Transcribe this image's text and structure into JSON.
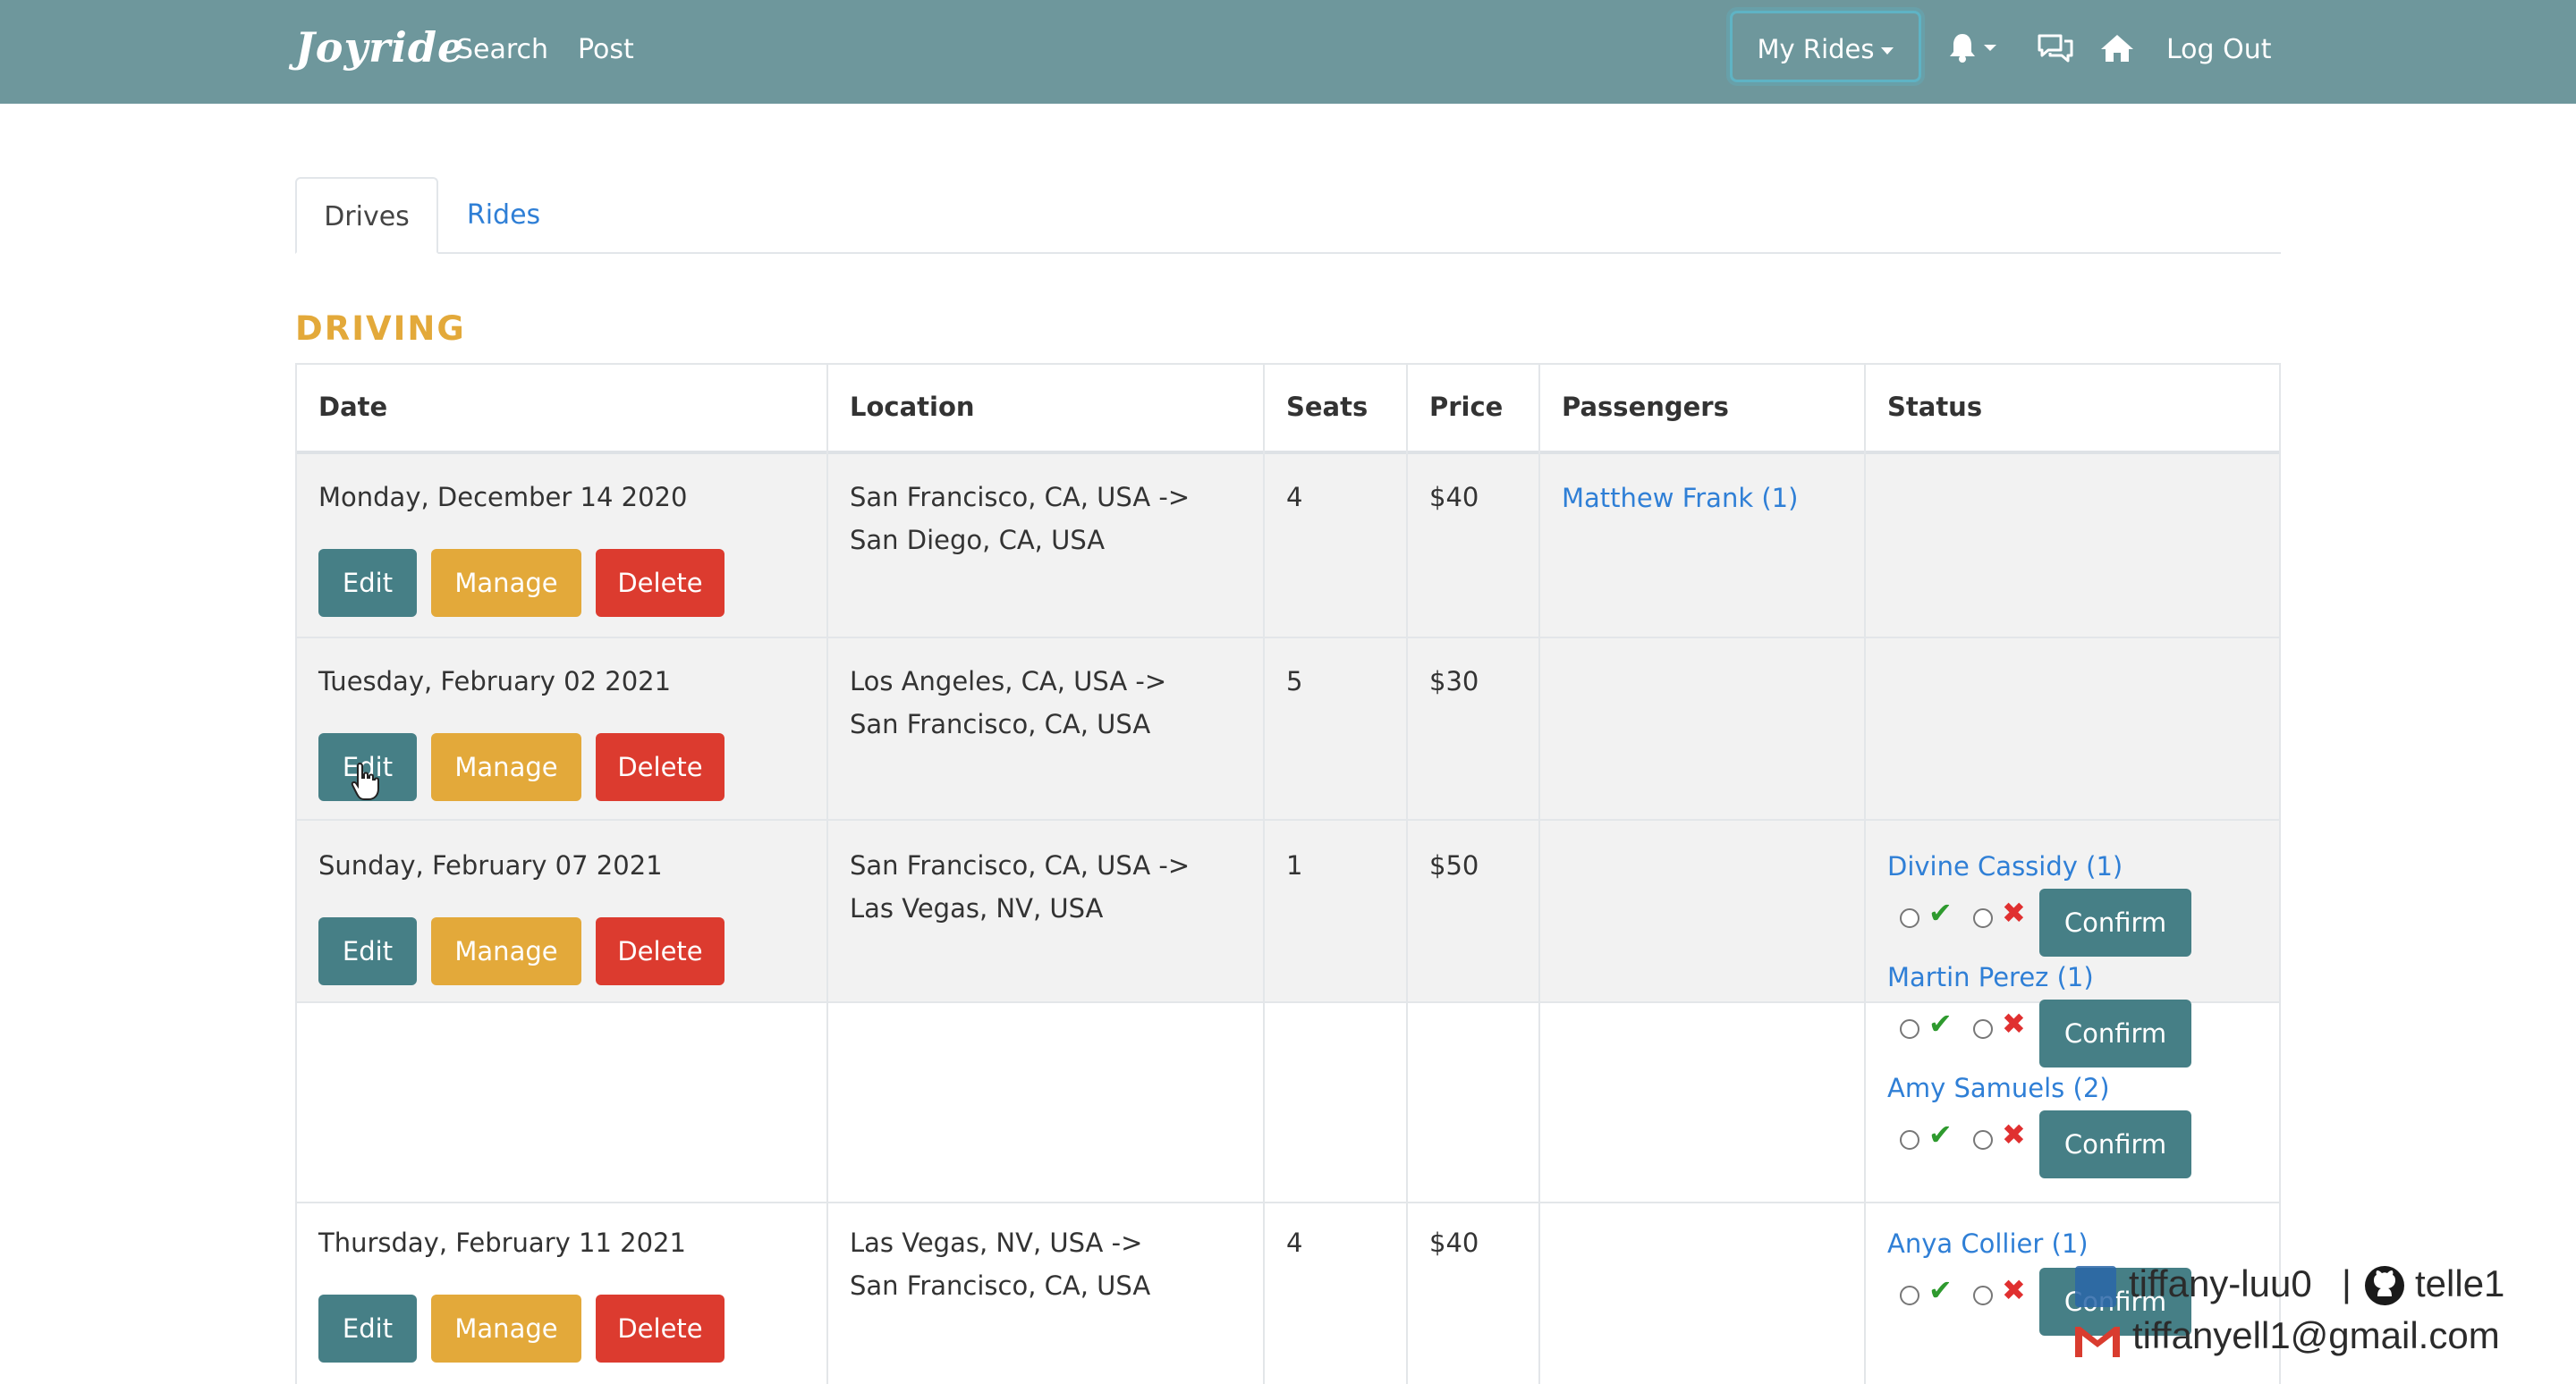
{
  "nav": {
    "brand": "Joyride",
    "search": "Search",
    "post": "Post",
    "my_rides": "My Rides",
    "logout": "Log Out"
  },
  "tabs": {
    "drives": "Drives",
    "rides": "Rides"
  },
  "section_title": "DRIVING",
  "table": {
    "headers": [
      "Date",
      "Location",
      "Seats",
      "Price",
      "Passengers",
      "Status"
    ],
    "buttons": {
      "edit": "Edit",
      "manage": "Manage",
      "delete": "Delete",
      "confirm": "Confirm"
    },
    "rows": [
      {
        "date": "Monday, December 14 2020",
        "from": "San Francisco, CA, USA ->",
        "to": "San Diego, CA, USA",
        "seats": "4",
        "price": "$40",
        "passengers": [
          "Matthew Frank (1)"
        ],
        "status": []
      },
      {
        "date": "Tuesday, February 02 2021",
        "from": "Los Angeles, CA, USA ->",
        "to": "San Francisco, CA, USA",
        "seats": "5",
        "price": "$30",
        "passengers": [],
        "status": []
      },
      {
        "date": "Sunday, February 07 2021",
        "from": "San Francisco, CA, USA ->",
        "to": "Las Vegas, NV, USA",
        "seats": "1",
        "price": "$50",
        "passengers": [],
        "status": [
          "Divine Cassidy (1)",
          "Martin Perez (1)",
          "Amy Samuels (2)"
        ]
      },
      {
        "date": "Thursday, February 11 2021",
        "from": "Las Vegas, NV, USA ->",
        "to": "San Francisco, CA, USA",
        "seats": "4",
        "price": "$40",
        "passengers": [],
        "status": [
          "Anya Collier (1)"
        ]
      }
    ]
  },
  "watermark": {
    "github_user": "tiffany-luu0",
    "separator": "|",
    "github_name": "telle1",
    "email": "tiffanyell1@gmail.com"
  },
  "colors": {
    "navbar": "#6e979c",
    "accent_orange": "#e3a93a",
    "edit_teal": "#467f86",
    "delete_red": "#dc3b2f",
    "link_blue": "#2f7fd6"
  },
  "icons": [
    "bell-icon",
    "chat-icon",
    "home-icon",
    "check-icon",
    "cross-icon",
    "linkedin-icon",
    "github-icon",
    "gmail-icon",
    "pointer-cursor-icon"
  ]
}
